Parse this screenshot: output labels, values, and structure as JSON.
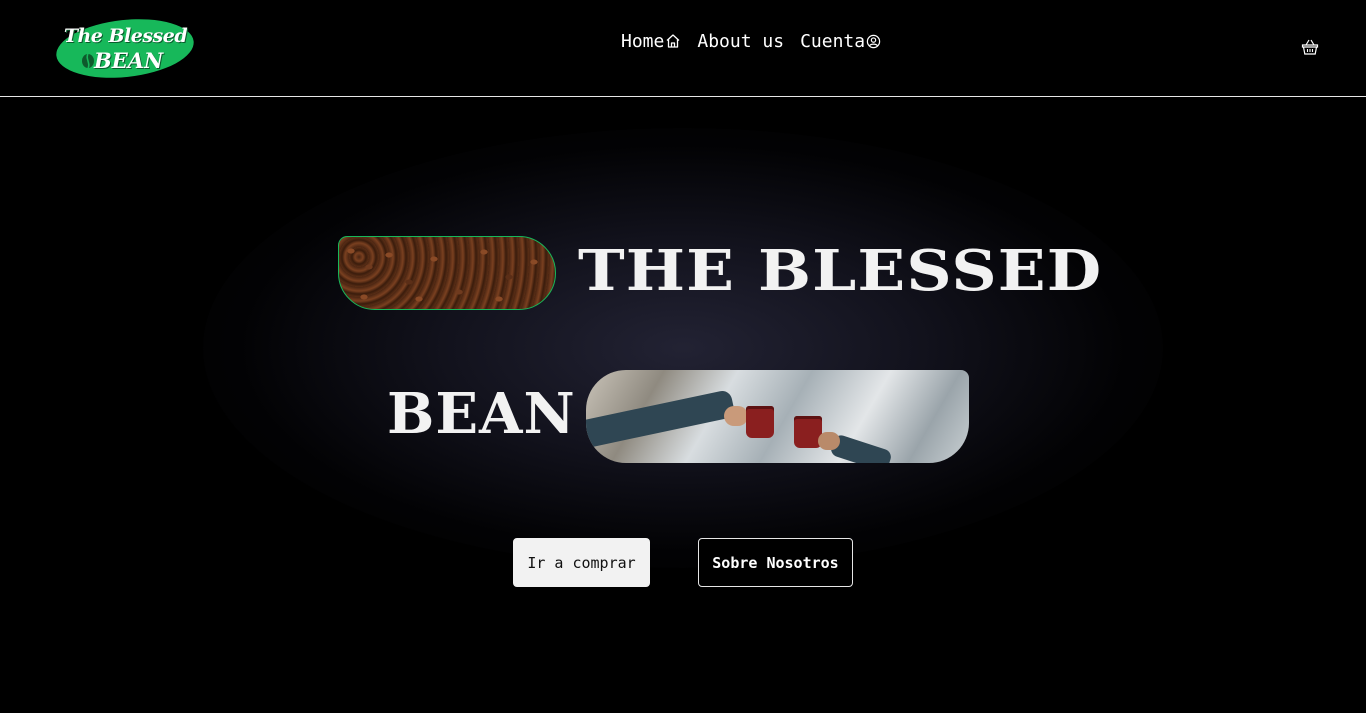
{
  "brand": {
    "logo_line1": "The Blessed",
    "logo_line2": "BEAN",
    "accent_color": "#17b85a"
  },
  "nav": {
    "items": [
      {
        "label": "Home",
        "icon": "home-icon"
      },
      {
        "label": "About us",
        "icon": ""
      },
      {
        "label": "Cuenta",
        "icon": "user-circle-icon"
      }
    ],
    "cart_icon": "basket-icon"
  },
  "hero": {
    "title_line1": "THE BLESSED",
    "title_line2": "BEAN",
    "image1": "coffee-beans-image",
    "image2": "coffee-mugs-toast-image"
  },
  "actions": {
    "primary_label": "Ir a comprar",
    "secondary_label": "Sobre Nosotros"
  }
}
